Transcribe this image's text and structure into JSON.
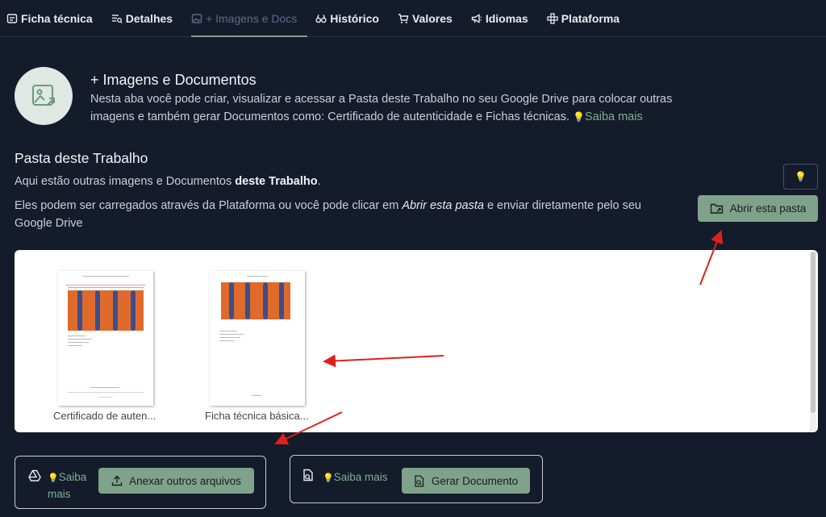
{
  "tabs": [
    {
      "label": "Ficha técnica",
      "icon": "spec-sheet-icon",
      "active": false
    },
    {
      "label": "Detalhes",
      "icon": "details-list-icon",
      "active": false
    },
    {
      "label": "+ Imagens e Docs",
      "icon": "images-icon",
      "active": true
    },
    {
      "label": "Histórico",
      "icon": "binoculars-icon",
      "active": false
    },
    {
      "label": "Valores",
      "icon": "cart-icon",
      "active": false
    },
    {
      "label": "Idiomas",
      "icon": "megaphone-icon",
      "active": false
    },
    {
      "label": "Plataforma",
      "icon": "platform-icon",
      "active": false
    }
  ],
  "hero": {
    "title": "+ Imagens e Documentos",
    "description": "Nesta aba você pode criar, visualizar e acessar a Pasta deste Trabalho no seu Google Drive para colocar outras imagens e também gerar Documentos como: Certificado de autenticidade e Fichas técnicas.",
    "link": "Saiba mais"
  },
  "folder": {
    "title": "Pasta deste Trabalho",
    "desc1_prefix": "Aqui estão outras imagens e Documentos ",
    "desc1_bold": "deste Trabalho",
    "desc1_suffix": ".",
    "desc2_prefix": "Eles podem ser carregados através da Plataforma ou você pode clicar em ",
    "desc2_italic": "Abrir esta pasta",
    "desc2_suffix": " e enviar diretamente pelo seu Google Drive",
    "open_button": "Abrir esta pasta"
  },
  "documents": [
    {
      "label": "Certificado de auten..."
    },
    {
      "label": "Ficha técnica básica..."
    }
  ],
  "actions": {
    "attach_saiba_1": "Saiba",
    "attach_saiba_2": "mais",
    "attach_button": "Anexar outros arquivos",
    "generate_saiba": "Saiba mais",
    "generate_button": "Gerar Documento"
  },
  "colors": {
    "background": "#141b2b",
    "accent": "#7fa28b",
    "link": "#7fb18e",
    "annotation_arrow": "#e0201c"
  }
}
